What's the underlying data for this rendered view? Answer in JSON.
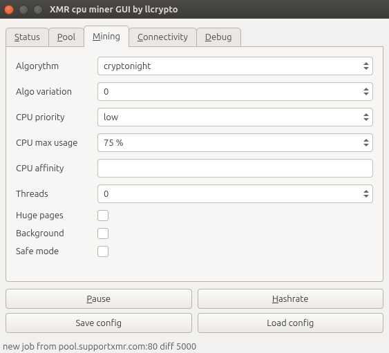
{
  "window": {
    "title": "XMR cpu miner GUI by llcrypto"
  },
  "tabs": {
    "status": "Status",
    "pool": "Pool",
    "mining": "Mining",
    "connectivity": "Connectivity",
    "debug": "Debug"
  },
  "form": {
    "algorythm": {
      "label": "Algorythm",
      "value": "cryptonight"
    },
    "algo_variation": {
      "label": "Algo variation",
      "value": "0"
    },
    "cpu_priority": {
      "label": "CPU priority",
      "value": "low"
    },
    "cpu_max_usage": {
      "label": "CPU max usage",
      "value": "75 %"
    },
    "cpu_affinity": {
      "label": "CPU affinity",
      "value": ""
    },
    "threads": {
      "label": "Threads",
      "value": "0"
    },
    "huge_pages": {
      "label": "Huge pages"
    },
    "background": {
      "label": "Background"
    },
    "safe_mode": {
      "label": "Safe mode"
    }
  },
  "buttons": {
    "pause": "Pause",
    "hashrate": "Hashrate",
    "save_config": "Save config",
    "load_config": "Load config"
  },
  "status_bar": "new job from pool.supportxmr.com:80 diff 5000"
}
